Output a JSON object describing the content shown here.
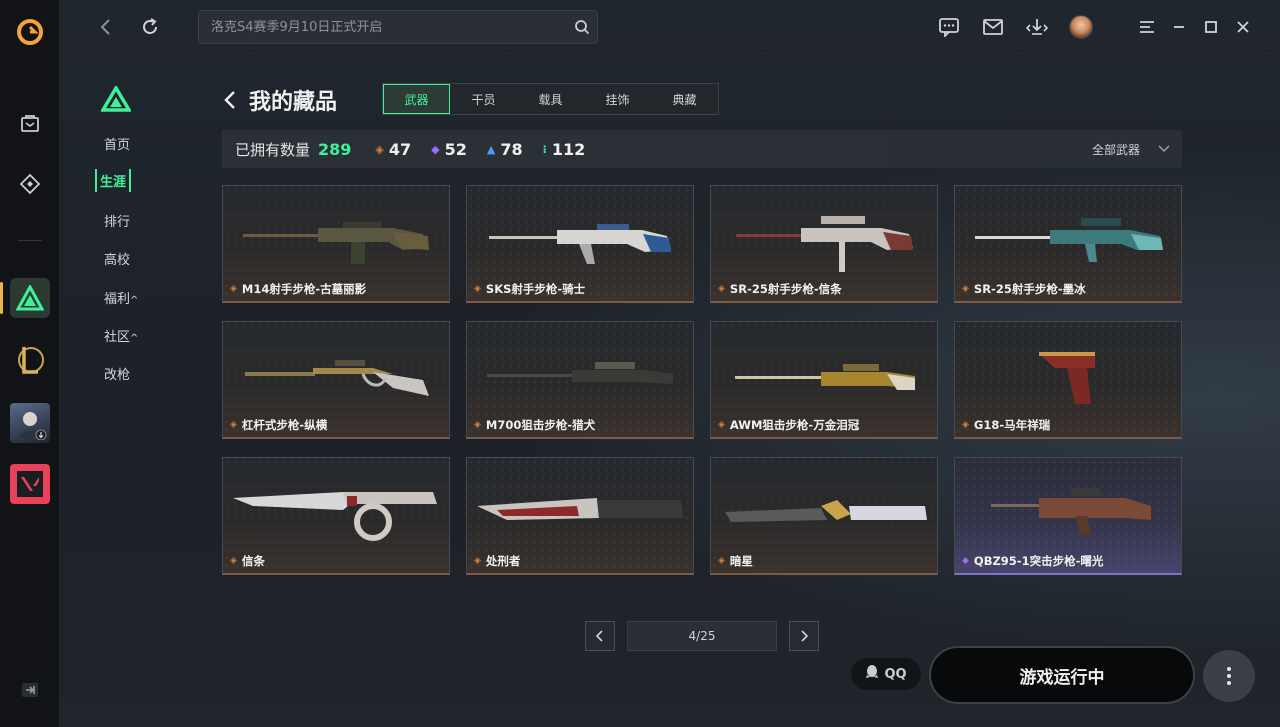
{
  "topbar": {
    "search_placeholder": "洛克S4赛季9月10日正式开启"
  },
  "subnav": {
    "items": [
      {
        "label": "首页"
      },
      {
        "label": "生涯"
      },
      {
        "label": "排行"
      },
      {
        "label": "高校"
      },
      {
        "label": "福利"
      },
      {
        "label": "社区"
      },
      {
        "label": "改枪"
      }
    ],
    "active": "生涯"
  },
  "header": {
    "title": "我的藏品",
    "tabs": [
      "武器",
      "干员",
      "载具",
      "挂饰",
      "典藏"
    ],
    "active_tab": "武器"
  },
  "stats": {
    "owned_label": "已拥有数量",
    "owned_total": "289",
    "counts": [
      {
        "value": "47",
        "color": "#d9843a"
      },
      {
        "value": "52",
        "color": "#9b6bff"
      },
      {
        "value": "78",
        "color": "#4a9cff"
      },
      {
        "value": "112",
        "color": "#3ff0c0"
      }
    ],
    "filter_label": "全部武器"
  },
  "items": [
    {
      "name": "M14射手步枪-古墓丽影",
      "rarity": "orange"
    },
    {
      "name": "SKS射手步枪-骑士",
      "rarity": "orange"
    },
    {
      "name": "SR-25射手步枪-信条",
      "rarity": "orange"
    },
    {
      "name": "SR-25射手步枪-墨冰",
      "rarity": "orange"
    },
    {
      "name": "杠杆式步枪-纵横",
      "rarity": "orange"
    },
    {
      "name": "M700狙击步枪-猎犬",
      "rarity": "orange"
    },
    {
      "name": "AWM狙击步枪-万金泪冠",
      "rarity": "orange"
    },
    {
      "name": "G18-马年祥瑞",
      "rarity": "orange"
    },
    {
      "name": "信条",
      "rarity": "orange"
    },
    {
      "name": "处刑者",
      "rarity": "orange"
    },
    {
      "name": "暗星",
      "rarity": "orange"
    },
    {
      "name": "QBZ95-1突击步枪-曙光",
      "rarity": "purple"
    }
  ],
  "pagination": {
    "page": "4/25"
  },
  "actions": {
    "qq_label": "QQ",
    "game_status": "游戏运行中"
  },
  "colors": {
    "accent": "#3ff09a",
    "rarity_orange": "#d9843a",
    "rarity_purple": "#9b6bff"
  }
}
